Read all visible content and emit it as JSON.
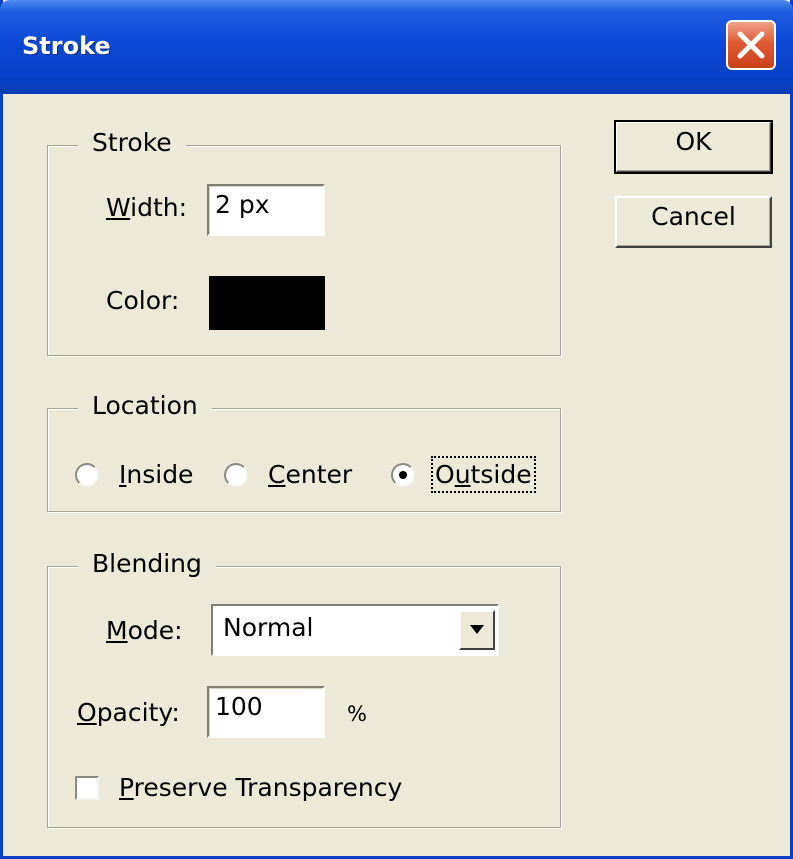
{
  "window": {
    "title": "Stroke",
    "close_icon": "close-icon"
  },
  "stroke_group": {
    "legend": "Stroke",
    "width_label": "Width:",
    "width_value": "2 px",
    "color_label": "Color:",
    "color_value": "#000000"
  },
  "location_group": {
    "legend": "Location",
    "options": [
      {
        "label": "Inside",
        "selected": false
      },
      {
        "label": "Center",
        "selected": false
      },
      {
        "label": "Outside",
        "selected": true
      }
    ]
  },
  "blending_group": {
    "legend": "Blending",
    "mode_label": "Mode:",
    "mode_value": "Normal",
    "opacity_label": "Opacity:",
    "opacity_value": "100",
    "opacity_unit": "%",
    "preserve_label": "Preserve Transparency",
    "preserve_checked": false
  },
  "buttons": {
    "ok": "OK",
    "cancel": "Cancel"
  }
}
